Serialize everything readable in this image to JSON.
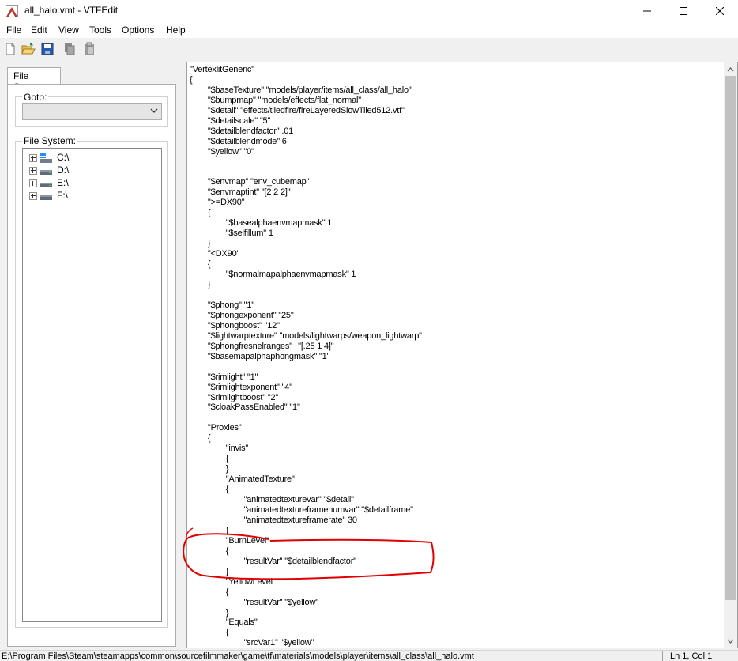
{
  "window": {
    "title": "all_halo.vmt - VTFEdit",
    "app_icon": "vtfedit-app-icon",
    "controls": [
      "minimize-icon",
      "maximize-icon",
      "close-icon"
    ]
  },
  "menu": {
    "items": [
      "File",
      "Edit",
      "View",
      "Tools",
      "Options",
      "Help"
    ]
  },
  "toolbar": {
    "buttons": [
      "new-file-icon",
      "open-folder-icon",
      "save-icon",
      "copy-icon",
      "paste-icon"
    ]
  },
  "left_panel": {
    "tab_label": "File System",
    "goto_label": "Goto:",
    "goto_value": "",
    "file_system_label": "File System:",
    "drives": [
      {
        "label": "C:\\",
        "icon": "windows-drive-icon"
      },
      {
        "label": "D:\\",
        "icon": "hard-drive-icon"
      },
      {
        "label": "E:\\",
        "icon": "hard-drive-icon"
      },
      {
        "label": "F:\\",
        "icon": "hard-drive-icon"
      }
    ]
  },
  "editor": {
    "content": "\"VertexlitGeneric\"\n{\n\t\"$baseTexture\" \"models/player/items/all_class/all_halo\"\n\t\"$bumpmap\" \"models/effects/flat_normal\"\n\t\"$detail\" \"effects/tiledfire/fireLayeredSlowTiled512.vtf\"\n\t\"$detailscale\" \"5\"\n\t\"$detailblendfactor\" .01\n\t\"$detailblendmode\" 6\n\t\"$yellow\" \"0\"\n\n\n\t\"$envmap\" \"env_cubemap\"\n\t\"$envmaptint\" \"[2 2 2]\"\n\t\">=DX90\"\n\t{\n\t\t\"$basealphaenvmapmask\" 1\n\t\t\"$selfillum\" 1\n\t}\n\t\"<DX90\"\n\t{\n\t\t\"$normalmapalphaenvmapmask\" 1\n\t}\n\n\t\"$phong\" \"1\"\n\t\"$phongexponent\" \"25\"\n\t\"$phongboost\" \"12\"\n\t\"$lightwarptexture\" \"models/lightwarps/weapon_lightwarp\"\n\t\"$phongfresnelranges\"\t\"[.25 1 4]\"\n\t\"$basemapalphaphongmask\" \"1\"\n\n\t\"$rimlight\" \"1\"\n\t\"$rimlightexponent\" \"4\"\n\t\"$rimlightboost\" \"2\"\n\t\"$cloakPassEnabled\" \"1\"\n\n\t\"Proxies\"\n\t{\n\t\t\"invis\"\n\t\t{\n\t\t}\n\t\t\"AnimatedTexture\"\n\t\t{\n\t\t\t\"animatedtexturevar\" \"$detail\"\n\t\t\t\"animatedtextureframenumvar\" \"$detailframe\"\n\t\t\t\"animatedtextureframerate\" 30\n\t\t}\n\t\t\"BurnLevel\"\n\t\t{\n\t\t\t\"resultVar\" \"$detailblendfactor\"\n\t\t}\n\t\t\"YellowLevel\"\n\t\t{\n\t\t\t\"resultVar\" \"$yellow\"\n\t\t}\n\t\t\"Equals\"\n\t\t{\n\t\t\t\"srcVar1\" \"$yellow\""
  },
  "status": {
    "path": "E:\\Program Files\\Steam\\steamapps\\common\\sourcefilmmaker\\game\\tf\\materials\\models\\player\\items\\all_class\\all_halo.vmt",
    "position": "Ln 1, Col 1"
  },
  "colors": {
    "annotation": "#e00000",
    "selection": "#cce8ff"
  }
}
